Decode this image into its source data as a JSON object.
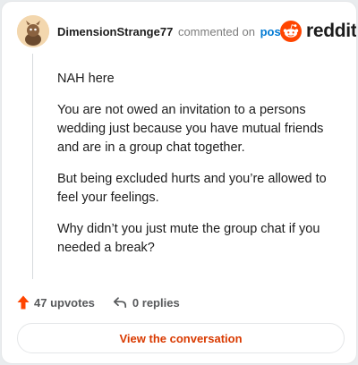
{
  "comment": {
    "username": "DimensionStrange77",
    "action_text": "commented on",
    "post_link": "post",
    "brand": "reddit",
    "brand_color": "#ff4500",
    "avatar_icon": "avatar-icon",
    "paragraphs": [
      "NAH here",
      "You are not owed an invitation to a persons wedding just because you have mutual friends and are in a group chat together.",
      "But being excluded hurts and you’re allowed to feel your feelings.",
      "Why didn’t you just mute the group chat if you needed a break?"
    ]
  },
  "footer": {
    "upvotes_label": "47 upvotes",
    "replies_label": "0 replies",
    "upvote_color": "#ff4500",
    "conversation_button": "View the conversation",
    "conversation_color": "#d93a00"
  }
}
